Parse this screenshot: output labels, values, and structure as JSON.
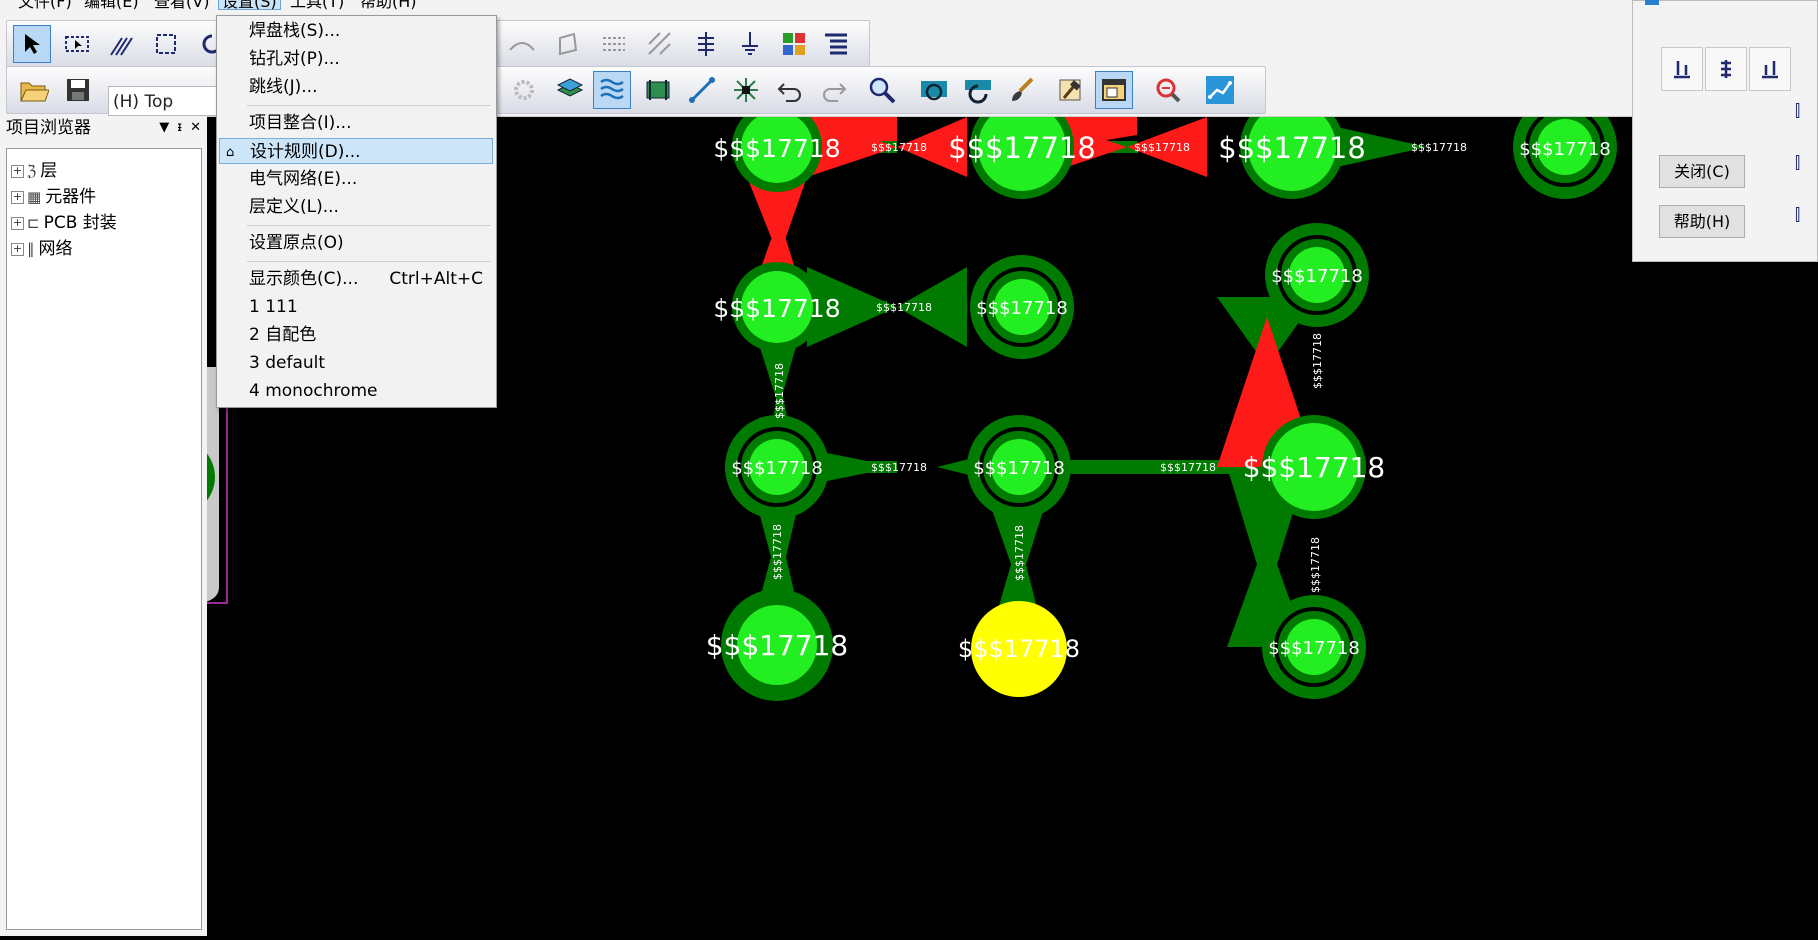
{
  "menubar": {
    "items": [
      "文件(F)",
      "编辑(E)",
      "查看(V)",
      "设置(S)",
      "工具(T)",
      "帮助(H)"
    ],
    "active_index": 3
  },
  "toolbar": {
    "layer_combo_value": "(H) Top"
  },
  "settings_menu": {
    "items": [
      {
        "label": "焊盘栈(S)...",
        "shortcut": ""
      },
      {
        "label": "钻孔对(P)...",
        "shortcut": ""
      },
      {
        "label": "跳线(J)...",
        "shortcut": ""
      },
      {
        "label": "项目整合(I)...",
        "shortcut": ""
      },
      {
        "label": "设计规则(D)...",
        "shortcut": ""
      },
      {
        "label": "电气网络(E)...",
        "shortcut": ""
      },
      {
        "label": "层定义(L)...",
        "shortcut": ""
      },
      {
        "label": "设置原点(O)",
        "shortcut": ""
      },
      {
        "label": "显示颜色(C)...",
        "shortcut": "Ctrl+Alt+C"
      },
      {
        "label": "1 111",
        "shortcut": ""
      },
      {
        "label": "2 自配色",
        "shortcut": ""
      },
      {
        "label": "3 default",
        "shortcut": ""
      },
      {
        "label": "4 monochrome",
        "shortcut": ""
      }
    ],
    "highlighted_index": 4
  },
  "project_browser": {
    "title": "项目浏览器",
    "tree": [
      {
        "label": "层",
        "icon": "layers-icon"
      },
      {
        "label": "元器件",
        "icon": "component-icon"
      },
      {
        "label": "PCB 封装",
        "icon": "footprint-icon"
      },
      {
        "label": "网络",
        "icon": "net-icon"
      }
    ]
  },
  "dialog": {
    "close_label": "关闭(C)",
    "help_label": "帮助(H)"
  },
  "pcb": {
    "net_label": "$$$17718",
    "colors": {
      "background": "#000000",
      "pad": "#22ee22",
      "copper": "#007a00",
      "violation": "#ff1a1a",
      "selected_pad": "#ffff00",
      "board_outline": "#c8c8c8"
    }
  }
}
